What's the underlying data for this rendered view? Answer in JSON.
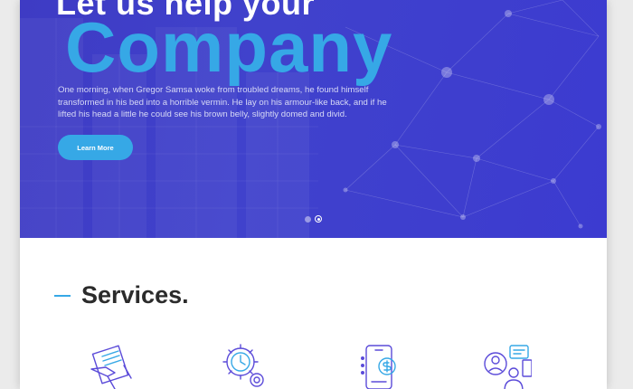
{
  "hero": {
    "heading_small": "Let us help your",
    "heading_big": "Company",
    "paragraph": "One morning, when Gregor Samsa woke from troubled dreams, he found himself transformed in his bed into a horrible vermin. He lay on his armour-like back, and if he lifted his head a little he could see his brown belly, slightly domed and divid.",
    "button_label": "Learn More",
    "slider_dots": 2,
    "active_dot": 2
  },
  "services": {
    "title": "Services.",
    "icons": [
      "document-pen-icon",
      "gear-clock-icon",
      "mobile-payment-icon",
      "support-agents-icon"
    ]
  },
  "colors": {
    "hero_background": "#3e3bc4",
    "accent_blue": "#36a8e6",
    "icon_purple": "#5b4bd9",
    "heading_dark": "#2b2b2b"
  }
}
